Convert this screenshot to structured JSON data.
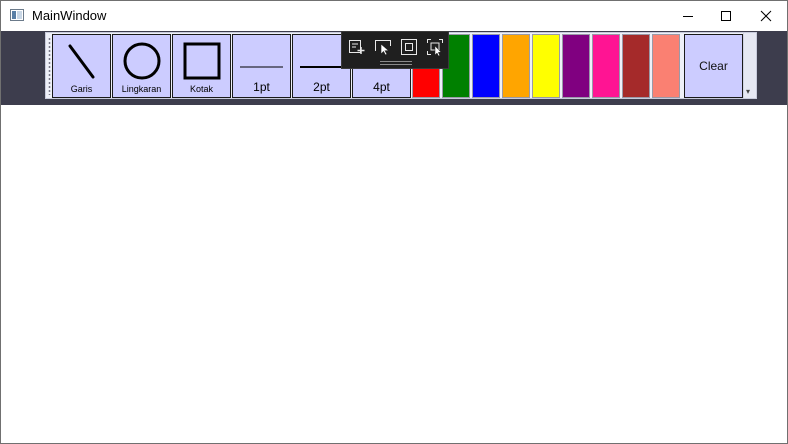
{
  "window": {
    "title": "MainWindow",
    "controls": {
      "minimize_icon": "minimize-icon",
      "maximize_icon": "maximize-icon",
      "close_icon": "close-icon"
    }
  },
  "toolbar": {
    "shape_tools": [
      {
        "label": "Garis",
        "icon": "line-icon"
      },
      {
        "label": "Lingkaran",
        "icon": "circle-icon"
      },
      {
        "label": "Kotak",
        "icon": "square-icon"
      }
    ],
    "thickness_tools": [
      {
        "label": "1pt",
        "icon": "thin-line-icon"
      },
      {
        "label": "2pt",
        "icon": "medium-line-icon"
      },
      {
        "label": "4pt",
        "icon": "thick-line-icon"
      }
    ],
    "colors": [
      {
        "name": "red",
        "hex": "#ff0000"
      },
      {
        "name": "green",
        "hex": "#008000"
      },
      {
        "name": "blue",
        "hex": "#0000ff"
      },
      {
        "name": "orange",
        "hex": "#ffa500"
      },
      {
        "name": "yellow",
        "hex": "#ffff00"
      },
      {
        "name": "purple",
        "hex": "#800080"
      },
      {
        "name": "deep-pink",
        "hex": "#ff1493"
      },
      {
        "name": "brown",
        "hex": "#a52a2a"
      },
      {
        "name": "salmon",
        "hex": "#fa8072"
      }
    ],
    "clear_label": "Clear",
    "overflow_glyph": "▾"
  },
  "debug_toolbar": {
    "buttons": [
      {
        "icon": "live-visual-tree-icon"
      },
      {
        "icon": "select-element-icon"
      },
      {
        "icon": "display-layout-adorners-icon"
      },
      {
        "icon": "track-focused-element-icon"
      }
    ]
  },
  "theme": {
    "tray_background": "#3d3d4d",
    "tool_background": "#ccccff",
    "canvas_background": "#ffffff"
  }
}
